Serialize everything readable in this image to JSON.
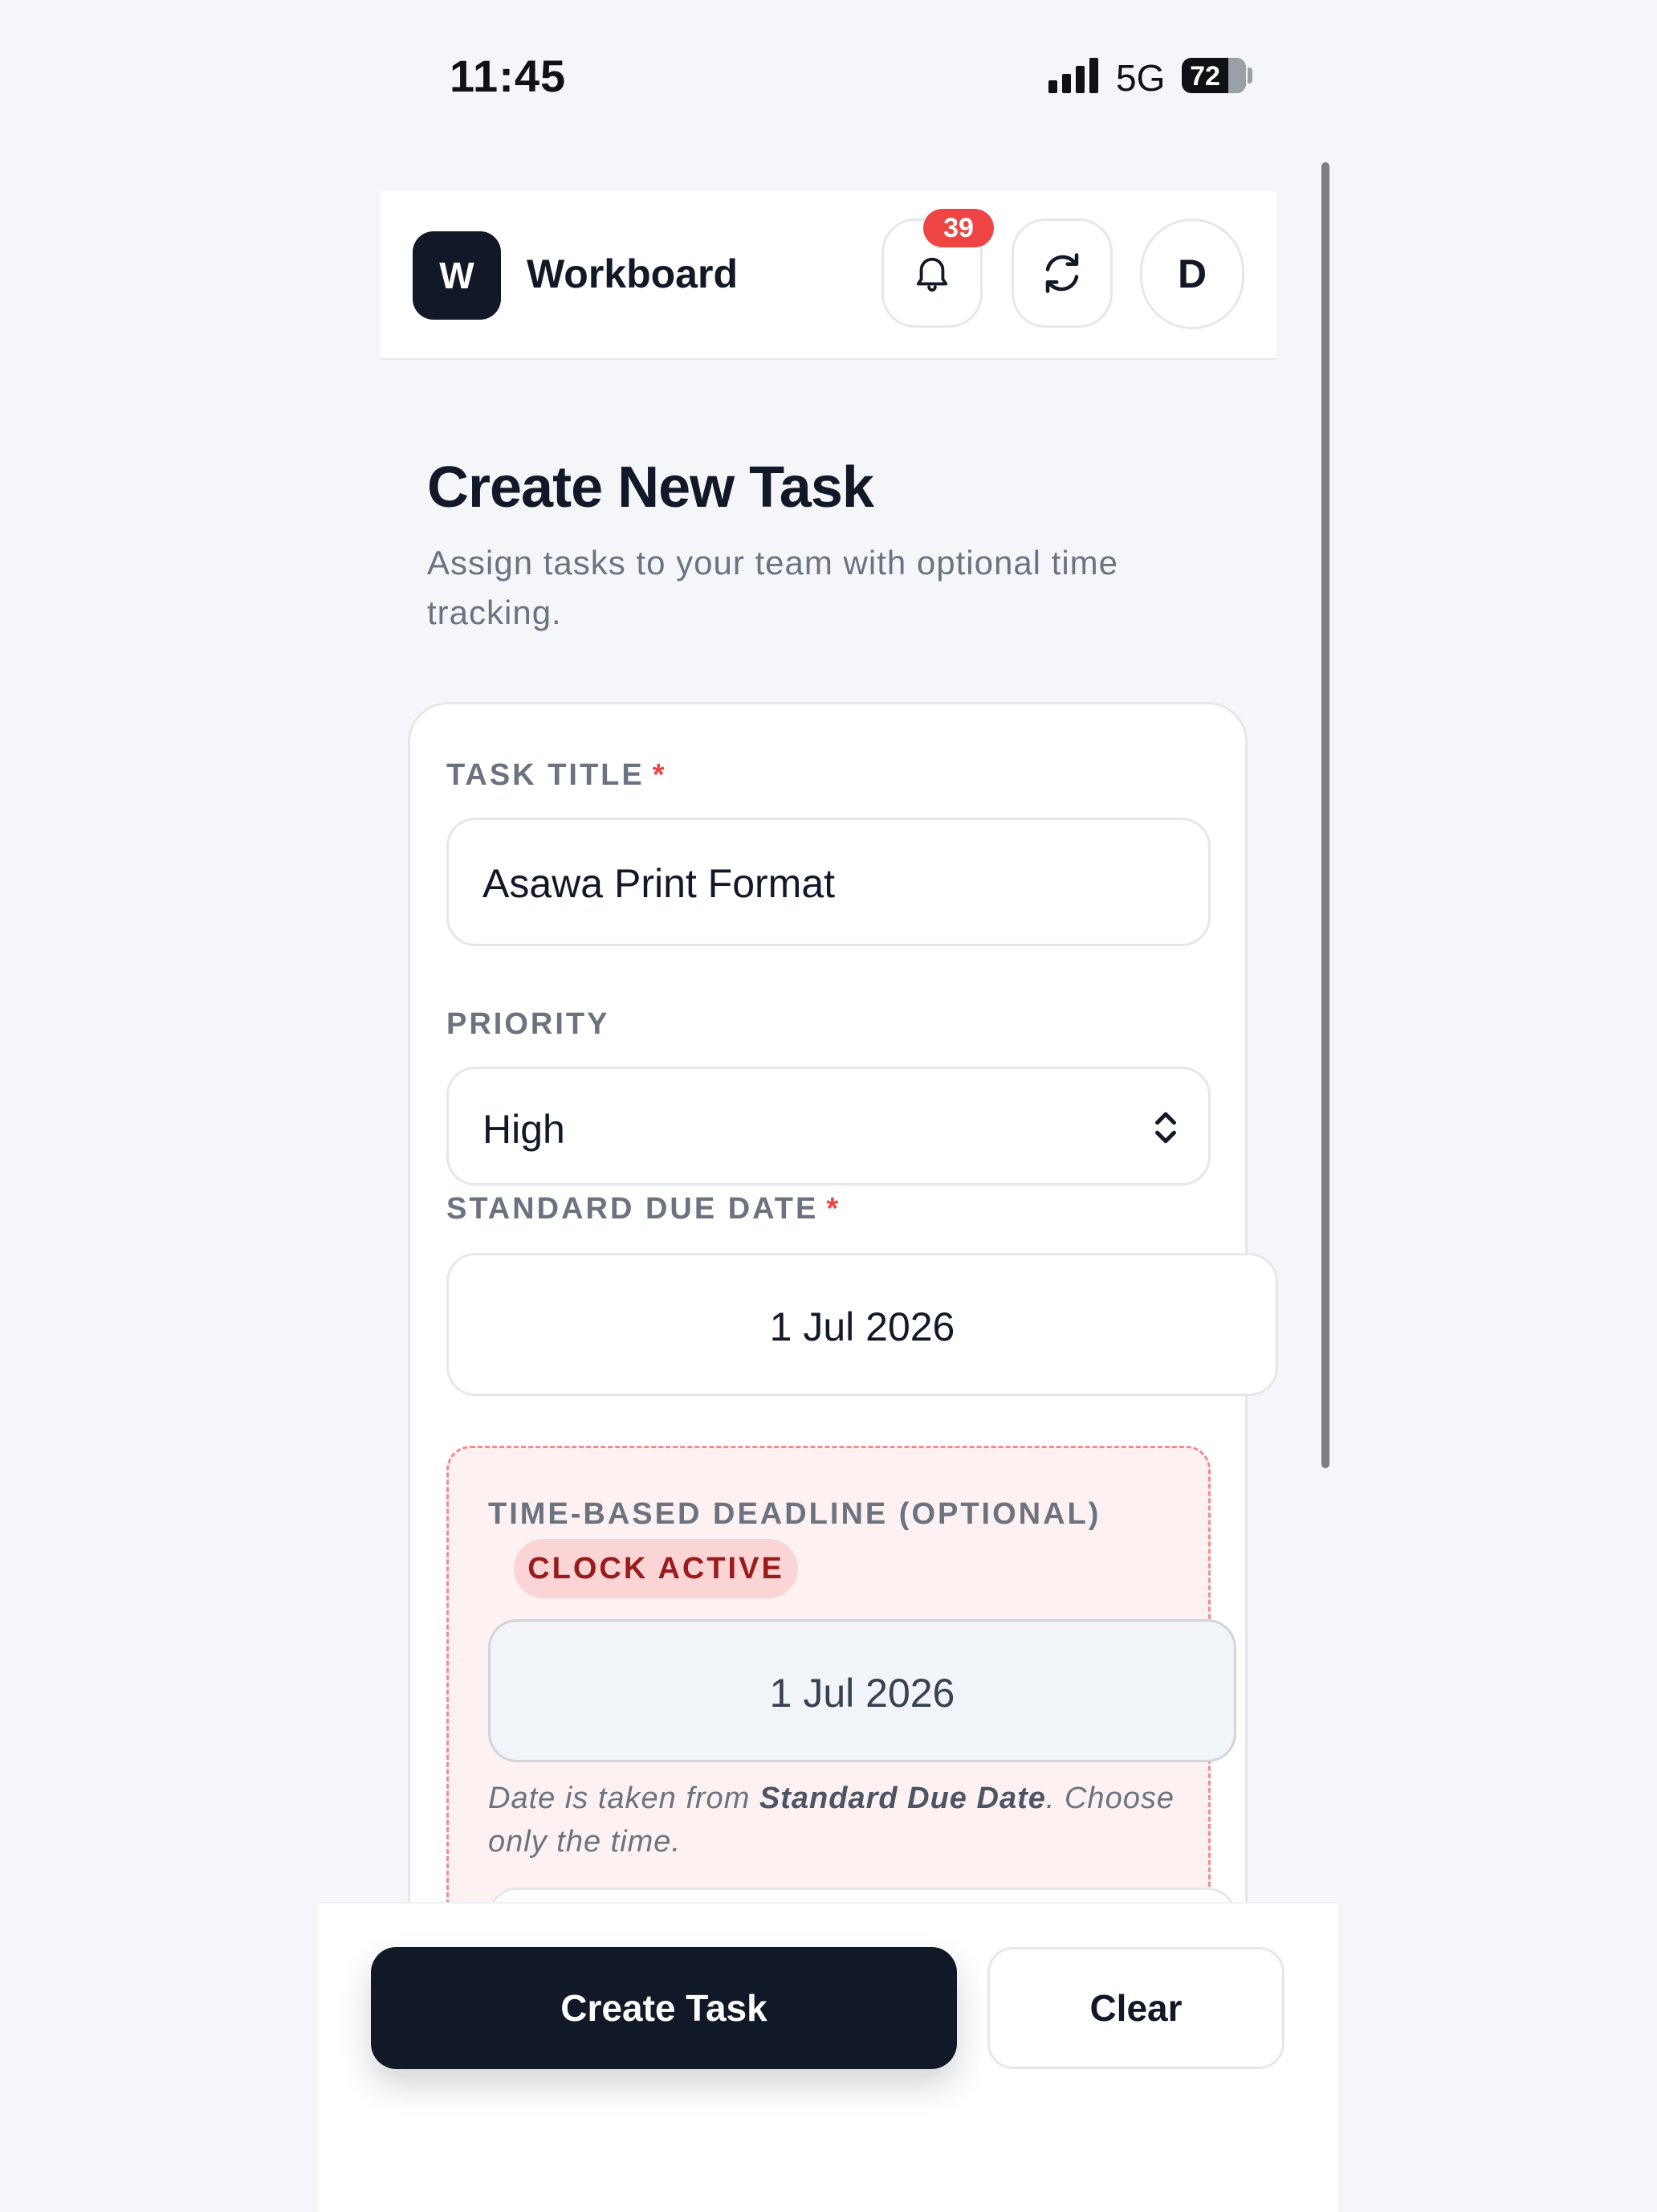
{
  "status_bar": {
    "time": "11:45",
    "network": "5G",
    "battery": "72"
  },
  "header": {
    "logo_letter": "W",
    "brand": "Workboard",
    "notification_count": "39",
    "avatar_initial": "D"
  },
  "page": {
    "title": "Create New Task",
    "subtitle": "Assign tasks to your team with optional time tracking."
  },
  "form": {
    "task_title_label": "TASK TITLE",
    "required_mark": "*",
    "task_title_value": "Asawa Print Format",
    "priority_label": "PRIORITY",
    "priority_value": "High",
    "due_date_label": "STANDARD DUE DATE",
    "due_date_value": "1 Jul 2026",
    "time_deadline_label": "TIME-BASED DEADLINE (OPTIONAL)",
    "clock_status": "CLOCK ACTIVE",
    "deadline_date_value": "1 Jul 2026",
    "hint_prefix": "Date is taken from ",
    "hint_bold": "Standard Due Date",
    "hint_suffix": ". Choose only the time."
  },
  "actions": {
    "create_label": "Create Task",
    "clear_label": "Clear"
  },
  "icons": {
    "notification": "bell-icon",
    "refresh": "refresh-icon",
    "select": "chevron-up-down-icon"
  }
}
